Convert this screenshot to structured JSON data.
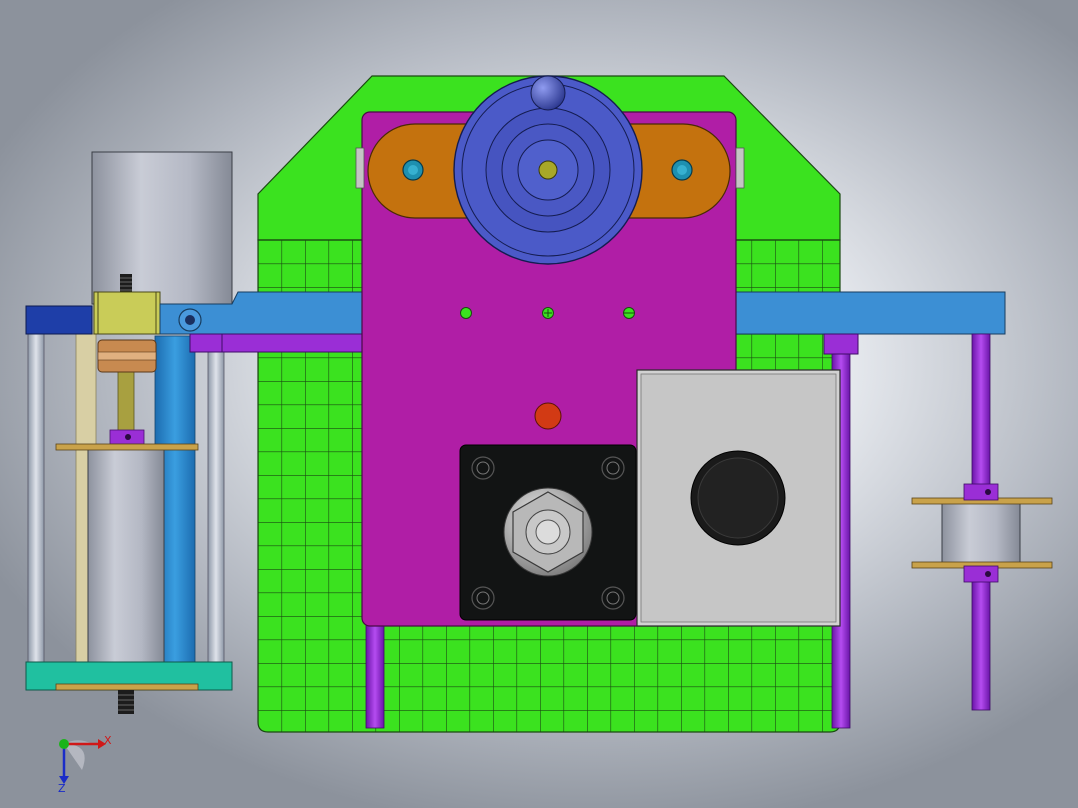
{
  "viewport": {
    "background_center": "#fbfcfe",
    "background_edge": "#8c929c"
  },
  "triad": {
    "x_label": "X",
    "z_label": "Z",
    "x_color": "#d01818",
    "y_color": "#19b419",
    "z_color": "#1a2cc8"
  },
  "colors": {
    "frame_green": "#3be21f",
    "plate_magenta": "#b01ea6",
    "link_orange": "#c4720e",
    "wheel_blue": "#4b5ac8",
    "arm_blue": "#3c8fd4",
    "cylinder_grey": "#b4b8c4",
    "motor_box_grey": "#cfd0d2",
    "base_teal": "#20c0a0",
    "rod_purple": "#9a2ed6"
  }
}
